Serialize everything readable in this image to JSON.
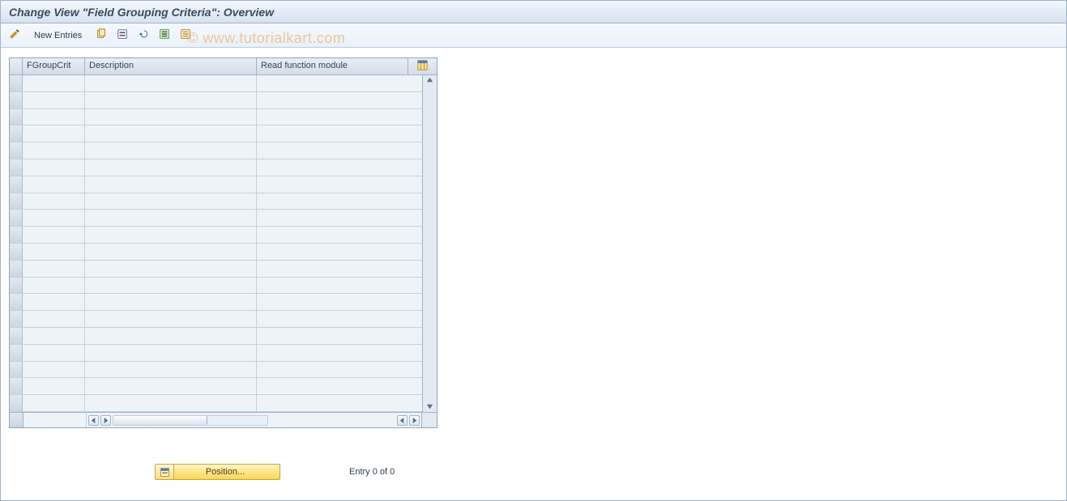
{
  "title": "Change View \"Field Grouping Criteria\": Overview",
  "watermark": "© www.tutorialkart.com",
  "toolbar": {
    "new_entries_label": "New Entries",
    "icons": {
      "pencil_name": "toggle-change-icon",
      "copy_name": "copy-as-icon",
      "delete_name": "delete-icon",
      "undo_name": "undo-change-icon",
      "select_all_name": "select-all-icon",
      "deselect_all_name": "deselect-all-icon"
    }
  },
  "table": {
    "columns": {
      "c1": "FGroupCrit",
      "c2": "Description",
      "c3": "Read function module"
    },
    "row_count": 20
  },
  "footer": {
    "position_label": "Position...",
    "entry_text": "Entry 0 of 0"
  }
}
